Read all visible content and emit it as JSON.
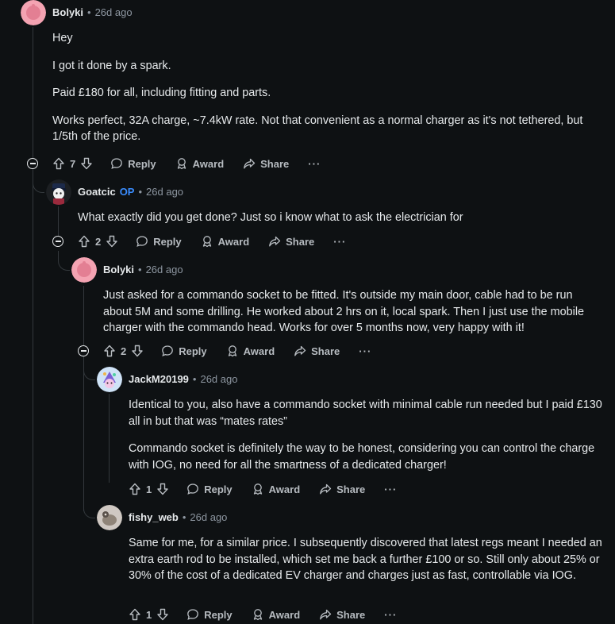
{
  "comments": [
    {
      "user": "Bolyki",
      "op": "",
      "time": "26d ago",
      "paragraphs": [
        "Hey",
        "I got it done by a spark.",
        "Paid £180 for all, including fitting and parts.",
        "Works perfect, 32A charge, ~7.4kW rate. Not that convenient as a normal charger as it's not tethered, but 1/5th of the price."
      ],
      "votes": "7"
    },
    {
      "user": "Goatcic",
      "op": "OP",
      "time": "26d ago",
      "paragraphs": [
        "What exactly did you get done? Just so i know what to ask the electrician for"
      ],
      "votes": "2"
    },
    {
      "user": "Bolyki",
      "op": "",
      "time": "26d ago",
      "paragraphs": [
        "Just asked for a commando socket to be fitted. It's outside my main door, cable had to be run about 5M and some drilling. He worked about 2 hrs on it, local spark. Then I just use the mobile charger with the commando head. Works for over 5 months now, very happy with it!"
      ],
      "votes": "2"
    },
    {
      "user": "JackM20199",
      "op": "",
      "time": "26d ago",
      "paragraphs": [
        "Identical to you, also have a commando socket with minimal cable run needed but I paid £130 all in but that was “mates rates”",
        "Commando socket is definitely the way to be honest, considering you can control the charge with IOG, no need for all the smartness of a dedicated charger!"
      ],
      "votes": "1"
    },
    {
      "user": "fishy_web",
      "op": "",
      "time": "26d ago",
      "paragraphs": [
        "Same for me, for a similar price. I subsequently discovered that latest regs meant I needed an extra earth rod to be installed, which set me back a further £100 or so. Still only about 25% or 30% of the cost of a dedicated EV charger and charges just as fast, controllable via IOG."
      ],
      "votes": "1"
    }
  ],
  "labels": {
    "reply": "Reply",
    "award": "Award",
    "share": "Share",
    "more": "···",
    "separator": "•"
  },
  "colors": {
    "background": "#0e1113",
    "op_badge": "#3a8dff",
    "thread_line": "#33383c"
  }
}
